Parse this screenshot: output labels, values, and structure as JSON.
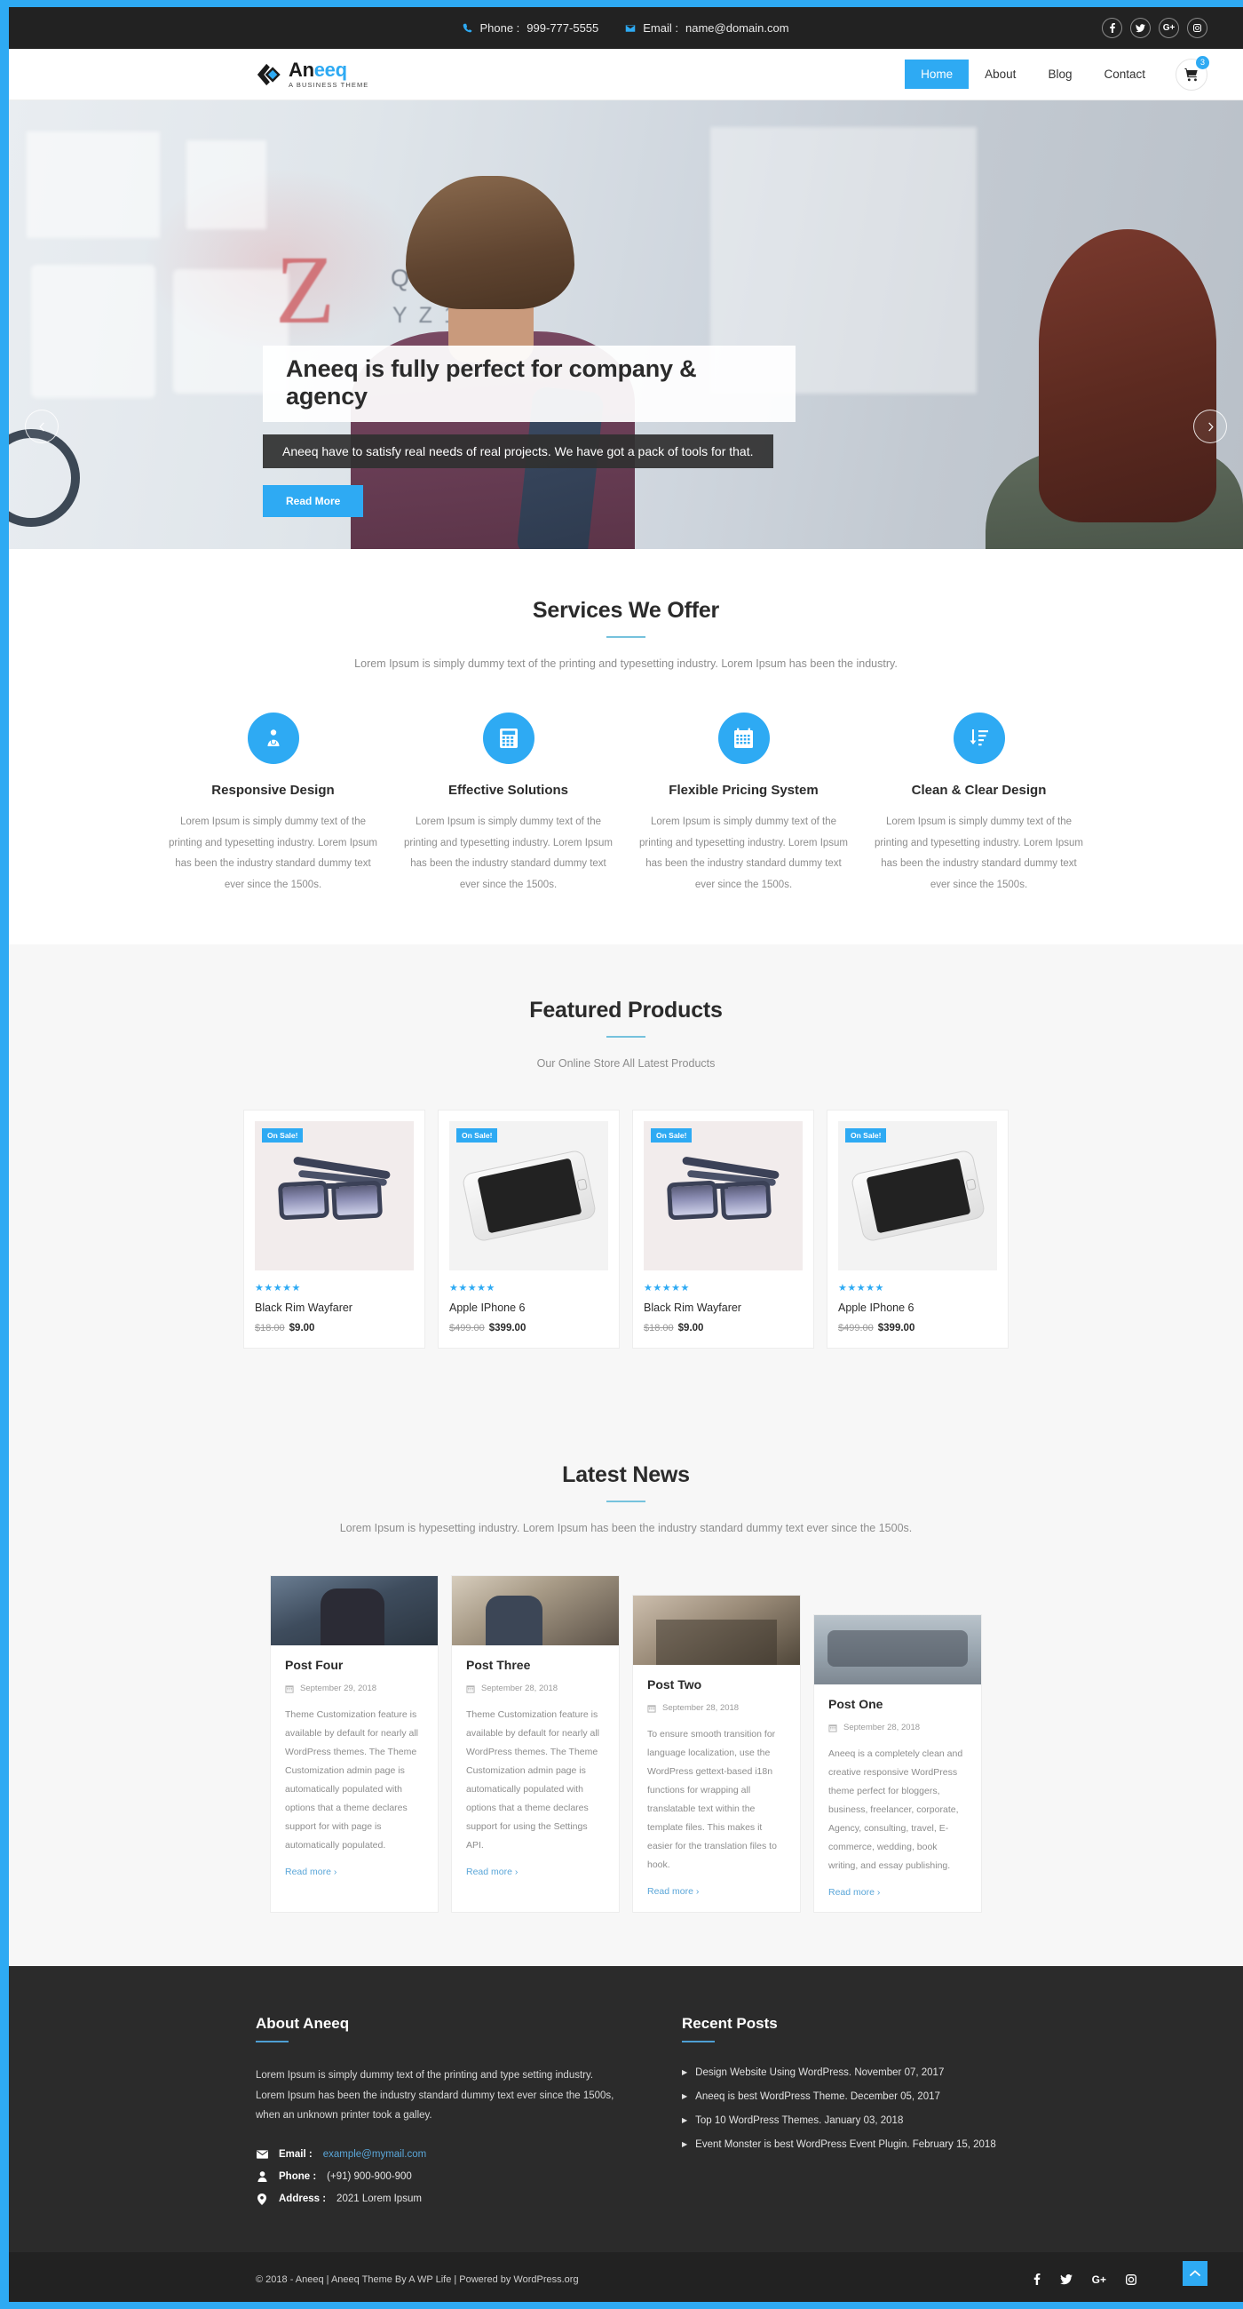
{
  "theme": {
    "accent": "#2eaaf3",
    "dark": "#222222",
    "footer_bg": "#2b2b2b",
    "muted_text": "#8d8d8d",
    "rule": "#76c2dd"
  },
  "topbar": {
    "phone_label": "Phone :",
    "phone_value": "999-777-5555",
    "email_label": "Email :",
    "email_value": "name@domain.com",
    "socials": [
      {
        "name": "facebook",
        "glyph": "f"
      },
      {
        "name": "twitter",
        "glyph": "t"
      },
      {
        "name": "google-plus",
        "glyph": "G+"
      },
      {
        "name": "instagram",
        "glyph": "ig"
      }
    ]
  },
  "header": {
    "logo_prefix": "An",
    "logo_accent": "eeq",
    "logo_tagline": "A BUSINESS THEME",
    "nav": [
      {
        "label": "Home",
        "active": true
      },
      {
        "label": "About",
        "active": false
      },
      {
        "label": "Blog",
        "active": false
      },
      {
        "label": "Contact",
        "active": false
      }
    ],
    "cart_count": "3"
  },
  "hero": {
    "title": "Aneeq is fully perfect for company & agency",
    "subtitle": "Aneeq have to satisfy real needs of real projects. We have got a pack of tools for that.",
    "button": "Read More",
    "prev_label": "Previous slide",
    "next_label": "Next slide",
    "board_letter": "Z",
    "board_row1": "QRS",
    "board_row2": "YZ1"
  },
  "services": {
    "title": "Services We Offer",
    "description": "Lorem Ipsum is simply dummy text of the printing and typesetting industry. Lorem Ipsum has been the industry.",
    "items": [
      {
        "icon": "user-md-icon",
        "title": "Responsive Design",
        "text": "Lorem Ipsum is simply dummy text of the printing and typesetting industry. Lorem Ipsum has been the industry standard dummy text ever since the 1500s."
      },
      {
        "icon": "calculator-icon",
        "title": "Effective Solutions",
        "text": "Lorem Ipsum is simply dummy text of the printing and typesetting industry. Lorem Ipsum has been the industry standard dummy text ever since the 1500s."
      },
      {
        "icon": "calendar-icon",
        "title": "Flexible Pricing System",
        "text": "Lorem Ipsum is simply dummy text of the printing and typesetting industry. Lorem Ipsum has been the industry standard dummy text ever since the 1500s."
      },
      {
        "icon": "sort-amount-down-icon",
        "title": "Clean & Clear Design",
        "text": "Lorem Ipsum is simply dummy text of the printing and typesetting industry. Lorem Ipsum has been the industry standard dummy text ever since the 1500s."
      }
    ]
  },
  "products": {
    "title": "Featured Products",
    "description": "Our Online Store All Latest Products",
    "badge": "On Sale!",
    "stars": "★★★★★",
    "items": [
      {
        "name": "Black Rim Wayfarer",
        "old_price": "$18.00",
        "new_price": "$9.00",
        "image": "sunglasses"
      },
      {
        "name": "Apple IPhone 6",
        "old_price": "$499.00",
        "new_price": "$399.00",
        "image": "phone"
      },
      {
        "name": "Black Rim Wayfarer",
        "old_price": "$18.00",
        "new_price": "$9.00",
        "image": "sunglasses"
      },
      {
        "name": "Apple IPhone 6",
        "old_price": "$499.00",
        "new_price": "$399.00",
        "image": "phone"
      }
    ]
  },
  "news": {
    "title": "Latest News",
    "description": "Lorem Ipsum is hypesetting industry. Lorem Ipsum has been the industry standard dummy text ever since the 1500s.",
    "read_more": "Read more ›",
    "items": [
      {
        "title": "Post Four",
        "date": "September 29, 2018",
        "excerpt": "Theme Customization feature is available by default for nearly all WordPress themes. The Theme Customization admin page is automatically populated with options that a theme declares support for with page is automatically populated."
      },
      {
        "title": "Post Three",
        "date": "September 28, 2018",
        "excerpt": "Theme Customization feature is available by default for nearly all WordPress themes. The Theme Customization admin page is automatically populated with options that a theme declares support for using the Settings API."
      },
      {
        "title": "Post Two",
        "date": "September 28, 2018",
        "excerpt": "To ensure smooth transition for language localization, use the WordPress gettext-based i18n functions for wrapping all translatable text within the template files. This makes it easier for the translation files to hook."
      },
      {
        "title": "Post One",
        "date": "September 28, 2018",
        "excerpt": "Aneeq is a completely clean and creative responsive WordPress theme perfect for bloggers, business, freelancer, corporate, Agency, consulting, travel, E-commerce, wedding, book writing, and essay publishing."
      }
    ]
  },
  "footer": {
    "about_title": "About Aneeq",
    "about_text": "Lorem Ipsum is simply dummy text of the printing and type setting industry. Lorem Ipsum has been the industry standard dummy text ever since the 1500s, when an unknown printer took a galley.",
    "email_label": "Email :",
    "email_value": "example@mymail.com",
    "phone_label": "Phone :",
    "phone_value": "(+91) 900-900-900",
    "address_label": "Address :",
    "address_value": "2021 Lorem Ipsum",
    "recent_title": "Recent Posts",
    "recent_posts": [
      "Design Website Using WordPress. November 07, 2017",
      "Aneeq is best WordPress Theme. December 05, 2017",
      "Top 10 WordPress Themes. January 03, 2018",
      "Event Monster is best WordPress Event Plugin. February 15, 2018"
    ],
    "copyright": "© 2018 - Aneeq | Aneeq Theme By A WP Life | Powered by WordPress.org",
    "socials": [
      {
        "name": "facebook",
        "glyph": "f"
      },
      {
        "name": "twitter",
        "glyph": "t"
      },
      {
        "name": "google-plus",
        "glyph": "G+"
      },
      {
        "name": "instagram",
        "glyph": "ig"
      }
    ],
    "back_to_top": "Back to top"
  }
}
